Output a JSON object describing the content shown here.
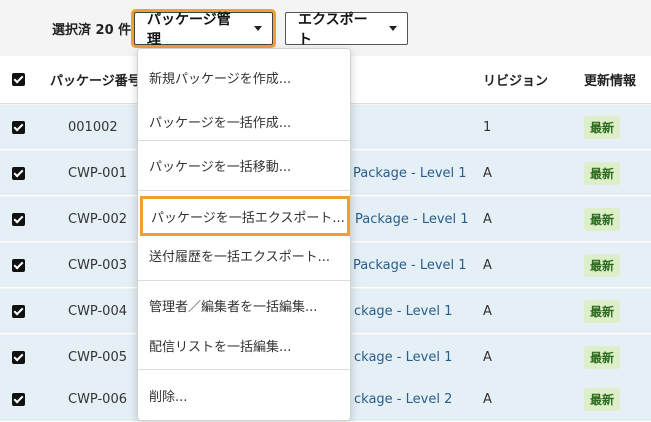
{
  "toolbar": {
    "selected_count": "選択済 20 件",
    "package_button": "パッケージ管理",
    "export_button": "エクスポート"
  },
  "table": {
    "headers": {
      "number": "パッケージ番号",
      "revision": "リビジョン",
      "update": "更新情報"
    },
    "rows": [
      {
        "number": "001002",
        "name": "",
        "revision": "1",
        "status": "最新"
      },
      {
        "number": "CWP-001",
        "name": "Package - Level 1",
        "revision": "A",
        "status": "最新"
      },
      {
        "number": "CWP-002",
        "name": "Package - Level 1",
        "revision": "A",
        "status": "最新"
      },
      {
        "number": "CWP-003",
        "name": "Package - Level 1",
        "revision": "A",
        "status": "最新"
      },
      {
        "number": "CWP-004",
        "name": "ckage - Level 1",
        "revision": "A",
        "status": "最新"
      },
      {
        "number": "CWP-005",
        "name": "ckage - Level 1",
        "revision": "A",
        "status": "最新"
      },
      {
        "number": "CWP-006",
        "name": "ckage - Level 2",
        "revision": "A",
        "status": "最新"
      }
    ]
  },
  "menu": {
    "items": [
      "新規パッケージを作成...",
      "パッケージを一括作成...",
      "パッケージを一括移動...",
      "パッケージを一括エクスポート...",
      "送付履歴を一括エクスポート...",
      "管理者／編集者を一括編集...",
      "配信リストを一括編集...",
      "削除..."
    ]
  },
  "colors": {
    "highlight": "#f0a030",
    "row_bg": "#e4f0f6",
    "badge_bg": "#dcefc9",
    "badge_text": "#2e6b1f",
    "link": "#2a5d8a"
  }
}
